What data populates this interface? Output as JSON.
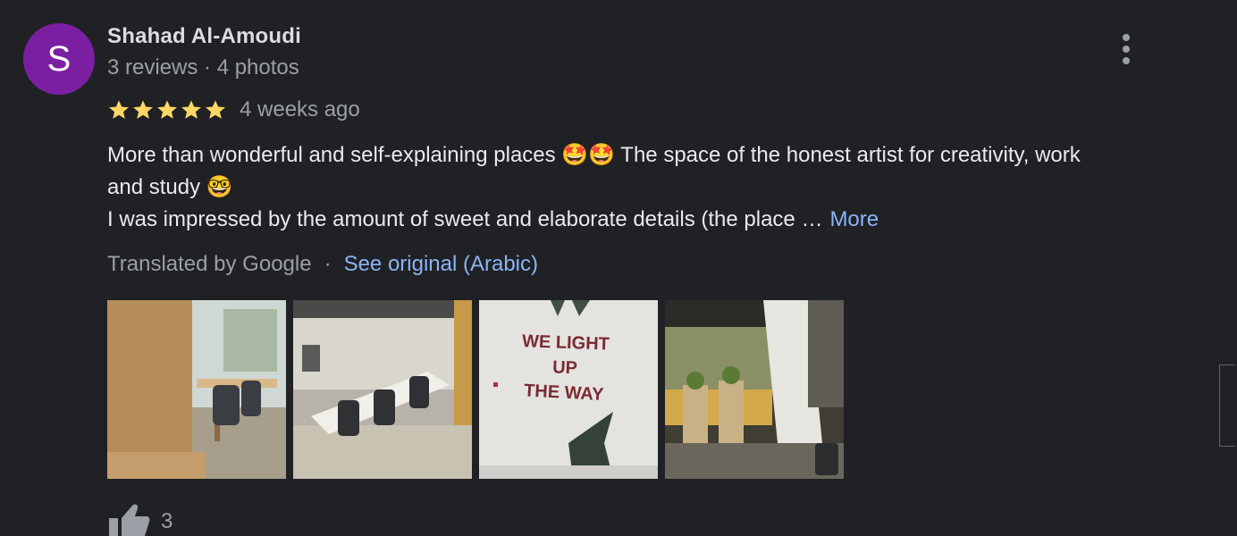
{
  "review": {
    "avatar_letter": "S",
    "author_name": "Shahad Al-Amoudi",
    "author_meta": "3 reviews · 4 photos",
    "rating": 5,
    "date": "4 weeks ago",
    "text_lines": [
      "More than wonderful and self-explaining places 🤩🤩 The space of the honest artist for creativity, work",
      "and study 🤓",
      "I was impressed by the amount of sweet and elaborate details (the place …"
    ],
    "more_label": "More",
    "translated_by": "Translated by Google",
    "separator": "·",
    "see_original": "See original (Arabic)",
    "photo_sign_text": [
      "WE LIGHT",
      "UP",
      "THE WAY"
    ],
    "like_count": "3"
  },
  "colors": {
    "background": "#202124",
    "avatar": "#7b1fa2",
    "star": "#fdd663",
    "link": "#8ab4f8",
    "muted": "#9aa0a6"
  },
  "icons": {
    "menu": "more-vert-icon",
    "star": "star-icon",
    "like": "thumb-up-icon"
  }
}
